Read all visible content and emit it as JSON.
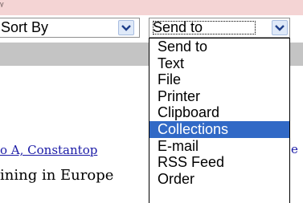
{
  "top_fragment": "y",
  "sort_by": {
    "value": "Sort By",
    "arrow_icon": "chevron-down-icon"
  },
  "send_to": {
    "value": "Send to",
    "arrow_icon": "chevron-down-icon",
    "options": [
      "Send to",
      "Text",
      "File",
      "Printer",
      "Clipboard",
      "Collections",
      "E-mail",
      "RSS Feed",
      "Order"
    ],
    "highlighted": "Collections"
  },
  "citation_fragment": "o A, Constantop",
  "snippet_fragment": "ining in Europe",
  "right_edge_fragment": "e",
  "colors": {
    "pink_band": "#f4d4d4",
    "gray_band": "#c4c4c4",
    "highlight": "#3169c6",
    "link": "#1a1aa6",
    "arrow_button": "#dfe9f8"
  }
}
